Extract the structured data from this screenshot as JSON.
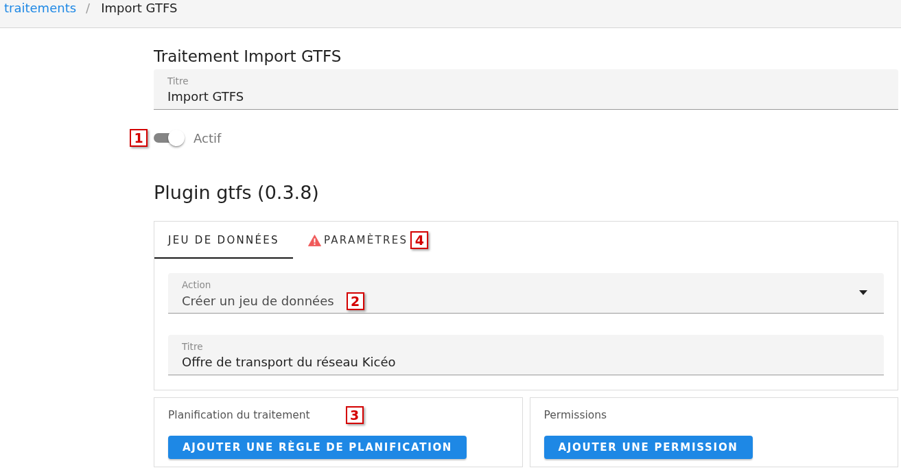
{
  "breadcrumbs": {
    "divider": "/",
    "items": [
      {
        "label": "traitements",
        "kind": "link"
      },
      {
        "label": "Import GTFS",
        "kind": "current"
      }
    ]
  },
  "page_title": "Traitement Import GTFS",
  "title_field": {
    "label": "Titre",
    "value": "Import GTFS"
  },
  "active_toggle": {
    "label": "Actif",
    "on": true,
    "marker": "1"
  },
  "plugin_title": "Plugin gtfs (0.3.8)",
  "plugin_card": {
    "tabs": [
      {
        "label": "JEU DE DONNÉES",
        "selected": true,
        "warning": false
      },
      {
        "label": "PARAMÈTRES",
        "selected": false,
        "warning": true,
        "marker": "4"
      }
    ],
    "fields": [
      {
        "kind": "select",
        "label": "Action",
        "value": "Créer un jeu de données",
        "marker": "2"
      },
      {
        "kind": "text",
        "label": "Titre",
        "value": "Offre de transport du réseau Kicéo"
      }
    ]
  },
  "sections": [
    {
      "title": "Planification du traitement",
      "button": "AJOUTER UNE RÈGLE DE PLANIFICATION",
      "marker": "3"
    },
    {
      "title": "Permissions",
      "button": "AJOUTER UNE PERMISSION"
    }
  ]
}
